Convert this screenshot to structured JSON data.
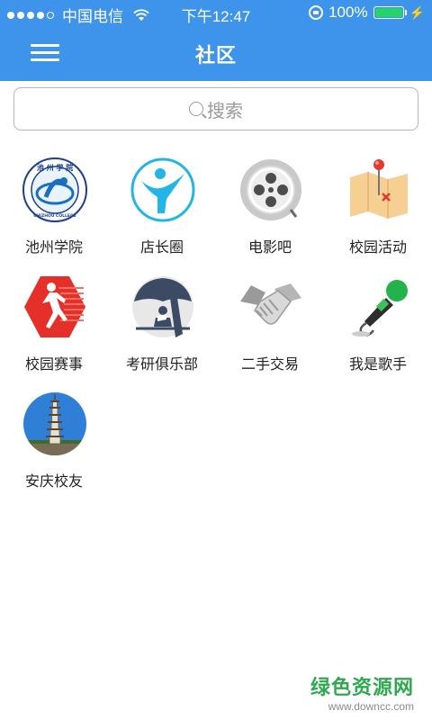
{
  "status_bar": {
    "carrier": "中国电信",
    "time": "下午12:47",
    "battery": "100%",
    "battery_level": 1.0
  },
  "navbar": {
    "title": "社区",
    "menu_icon": "hamburger-menu-icon"
  },
  "search": {
    "placeholder": "搜索",
    "icon": "search-icon"
  },
  "communities": [
    {
      "label": "池州学院",
      "icon": "chizhou-college-logo-icon",
      "logo_text": "池 州 学 院",
      "logo_sub": "CHIZHOU COLLEGE"
    },
    {
      "label": "店长圈",
      "icon": "person-swoosh-icon"
    },
    {
      "label": "电影吧",
      "icon": "film-reel-icon"
    },
    {
      "label": "校园活动",
      "icon": "map-pin-icon"
    },
    {
      "label": "校园赛事",
      "icon": "runner-icon"
    },
    {
      "label": "考研俱乐部",
      "icon": "reading-under-tree-icon"
    },
    {
      "label": "二手交易",
      "icon": "handshake-icon"
    },
    {
      "label": "我是歌手",
      "icon": "microphone-icon"
    },
    {
      "label": "安庆校友",
      "icon": "pagoda-photo-icon"
    }
  ],
  "watermark": {
    "title": "绿色资源网",
    "url": "www.downcc.com"
  },
  "colors": {
    "header": "#3d94ea",
    "watermark": "#2fa84f"
  }
}
